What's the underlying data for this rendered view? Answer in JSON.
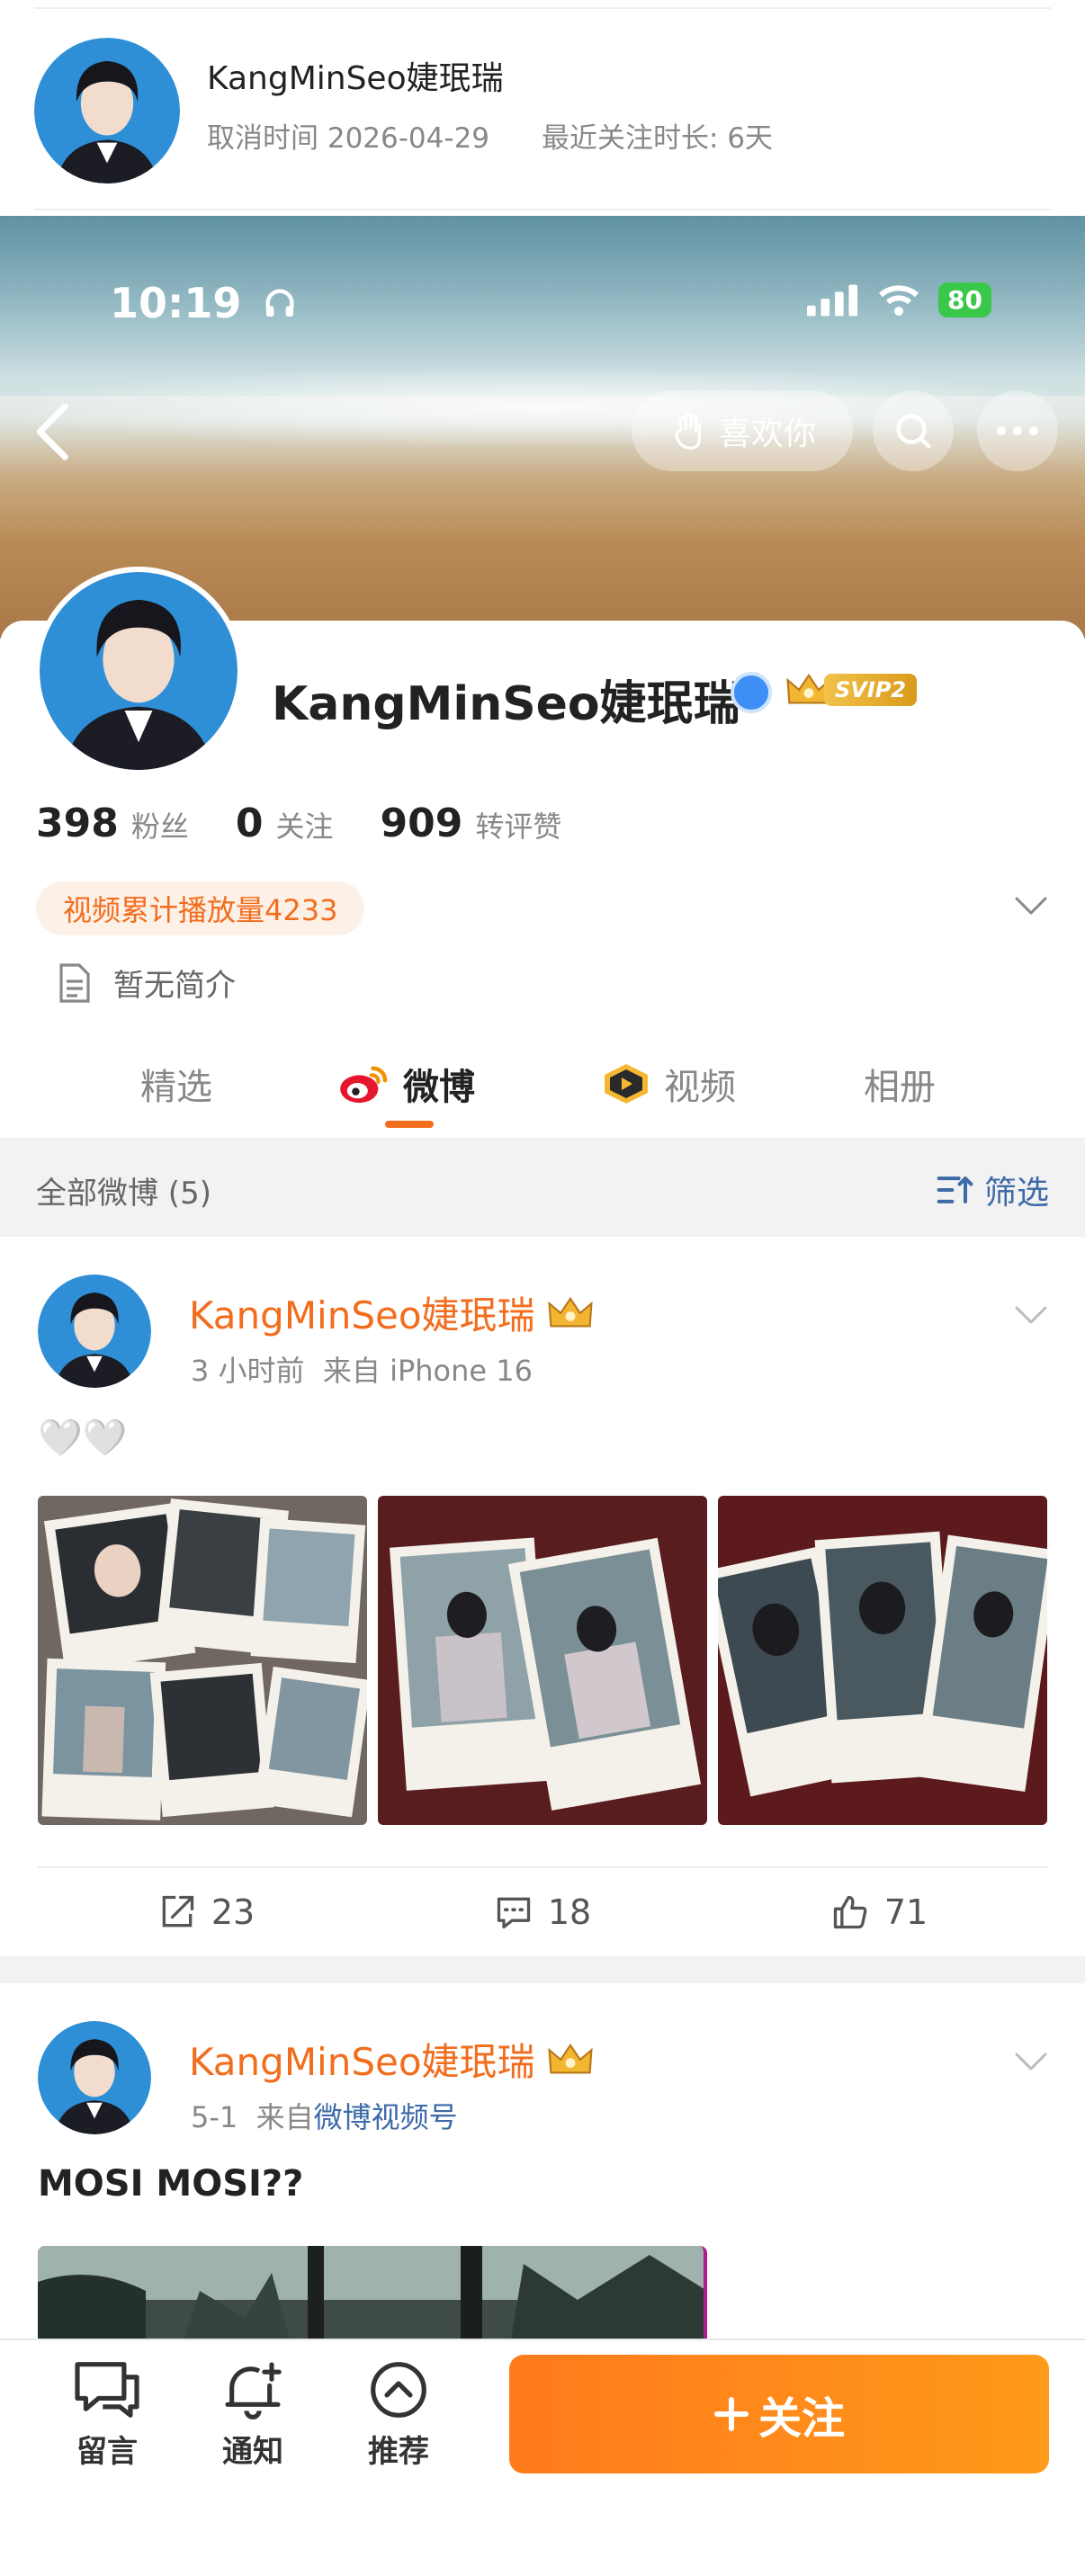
{
  "cancel_card": {
    "name": "KangMinSeo婕珉瑞",
    "cancel_label": "取消时间 2026-04-29",
    "duration_label": "最近关注时长: 6天"
  },
  "status_bar": {
    "time": "10:19",
    "battery": "80"
  },
  "header": {
    "like_label": "喜欢你"
  },
  "profile": {
    "name": "KangMinSeo婕珉瑞",
    "svip_label": "SVIP2",
    "stats": [
      {
        "value": "398",
        "label": "粉丝"
      },
      {
        "value": "0",
        "label": "关注"
      },
      {
        "value": "909",
        "label": "转评赞"
      }
    ],
    "play_count": "视频累计播放量4233",
    "bio": "暂无简介"
  },
  "tabs": [
    {
      "label": "精选"
    },
    {
      "label": "微博"
    },
    {
      "label": "视频"
    },
    {
      "label": "相册"
    }
  ],
  "filter": {
    "title": "全部微博 (5)",
    "button": "筛选"
  },
  "posts": [
    {
      "author": "KangMinSeo婕珉瑞",
      "time": "3 小时前",
      "source_prefix": "来自",
      "source": "iPhone 16",
      "text": "🤍🤍",
      "reposts": "23",
      "comments": "18",
      "likes": "71"
    },
    {
      "author": "KangMinSeo婕珉瑞",
      "time": "5-1",
      "source_prefix": "来自",
      "source": "微博视频号",
      "text": "MOSI MOSI??"
    }
  ],
  "bottom_bar": {
    "message": "留言",
    "notify": "通知",
    "recommend": "推荐",
    "follow": "关注"
  },
  "colors": {
    "accent": "#f26d1d",
    "link": "#3d6aa8",
    "follow_button": "#ff8a1c"
  }
}
